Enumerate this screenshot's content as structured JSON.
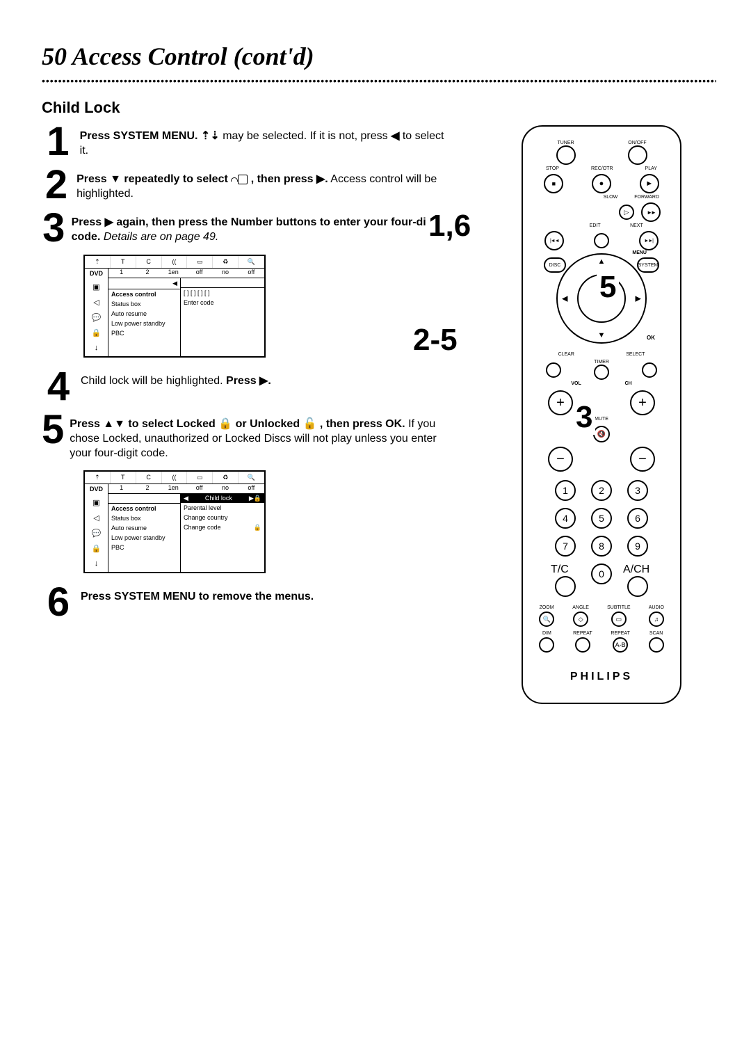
{
  "page": {
    "number": "50",
    "title": "Access Control (cont'd)",
    "section": "Child Lock"
  },
  "steps": {
    "s1": {
      "num": "1",
      "bold1": "Press SYSTEM MENU.",
      "t1": "may be selected. If it is not, press",
      "t2": "to select it."
    },
    "s2": {
      "num": "2",
      "bold1": "Press ▼ repeatedly to select",
      "bold2": ", then press ▶.",
      "t1": "Access control will be highlighted."
    },
    "s3": {
      "num": "3",
      "bold1": "Press ▶ again, then press the Number buttons to enter your four-digit code.",
      "italic1": "Details are on page 49."
    },
    "s4": {
      "num": "4",
      "t1": "Child lock will be highlighted.",
      "bold1": "Press ▶."
    },
    "s5": {
      "num": "5",
      "bold1": "Press ▲▼ to select Locked",
      "bold2": "or Unlocked",
      "bold3": ", then press OK.",
      "t1": "If you chose Locked, unauthorized or Locked Discs will not play unless you enter your four-digit code."
    },
    "s6": {
      "num": "6",
      "bold1": "Press SYSTEM MENU to remove the menus."
    }
  },
  "menu1": {
    "dvd": "DVD",
    "head": [
      "1",
      "2",
      "1en",
      "off",
      "no",
      "off"
    ],
    "mid": [
      "Access control",
      "Status box",
      "Auto resume",
      "Low power standby",
      "PBC"
    ],
    "right_top": "[ ]  [ ]  [ ]  [ ]",
    "right_sub": "Enter code"
  },
  "menu2": {
    "dvd": "DVD",
    "head": [
      "1",
      "2",
      "1en",
      "off",
      "no",
      "off"
    ],
    "cl": "Child lock",
    "mid": [
      "Access control",
      "Status box",
      "Auto resume",
      "Low power standby",
      "PBC"
    ],
    "right": [
      "Parental level",
      "Change country",
      "Change code"
    ]
  },
  "remote": {
    "top": {
      "tuner": "TUNER",
      "onoff": "ON/OFF"
    },
    "r2": {
      "stop": "STOP",
      "recotr": "REC/OTR",
      "play": "PLAY"
    },
    "r3": {
      "slow": "SLOW",
      "forward": "FORWARD"
    },
    "r4": {
      "edit": "EDIT",
      "next": "NEXT"
    },
    "menu": "MENU",
    "disc": "DISC",
    "system": "SYSTEM",
    "ok": "OK",
    "clear": "CLEAR",
    "select": "SELECT",
    "timer": "TIMER",
    "vol": "VOL",
    "ch": "CH",
    "mute": "MUTE",
    "nums": [
      "1",
      "2",
      "3",
      "4",
      "5",
      "6",
      "7",
      "8",
      "9"
    ],
    "tc": "T/C",
    "zero": "0",
    "avch": "A/CH",
    "row5": [
      "ZOOM",
      "ANGLE",
      "SUBTITLE",
      "AUDIO"
    ],
    "row6": [
      "DIM",
      "REPEAT",
      "REPEAT",
      "SCAN"
    ],
    "ab": "A-B",
    "brand": "PHILIPS"
  },
  "callouts": {
    "c1": "1,6",
    "c25": "2-5",
    "c5": "5",
    "c3": "3"
  }
}
